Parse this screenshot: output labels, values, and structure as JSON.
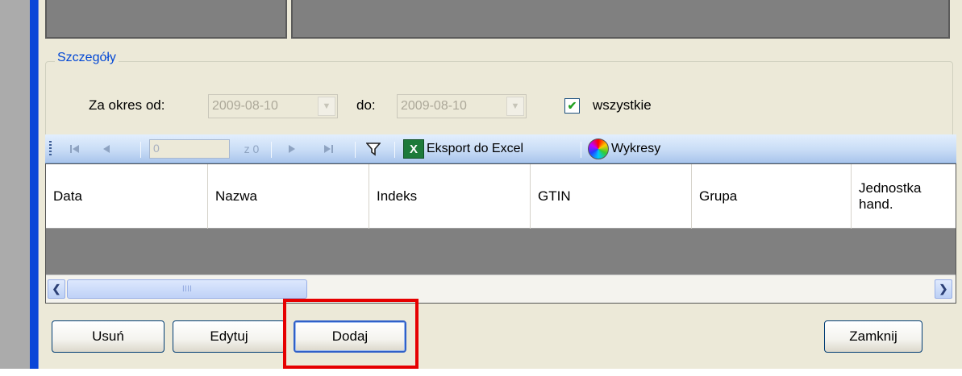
{
  "group": {
    "title": "Szczegóły"
  },
  "filter": {
    "from_label": "Za okres od:",
    "from_value": "2009-08-10",
    "to_label": "do:",
    "to_value": "2009-08-10",
    "all_label": "wszystkie",
    "all_checked": true
  },
  "toolbar": {
    "position_value": "0",
    "count_label": "z 0",
    "export_label": "Eksport do Excel",
    "charts_label": "Wykresy",
    "excel_icon_text": "X"
  },
  "grid": {
    "columns": [
      "Data",
      "Nazwa",
      "Indeks",
      "GTIN",
      "Grupa"
    ],
    "last_column_line1": "Jednostka",
    "last_column_line2": "hand.",
    "scroll_grip": "IIII"
  },
  "buttons": {
    "delete": "Usuń",
    "edit": "Edytuj",
    "add": "Dodaj",
    "close": "Zamknij"
  },
  "colors": {
    "window_border": "#0a46d8",
    "group_title": "#0046d5",
    "highlight": "#e60000",
    "face": "#ece9d8"
  },
  "icons": {
    "first": "first-record-icon",
    "prev": "previous-record-icon",
    "next": "next-record-icon",
    "last": "last-record-icon",
    "filter": "filter-icon",
    "excel": "excel-icon",
    "charts": "color-wheel-icon"
  }
}
